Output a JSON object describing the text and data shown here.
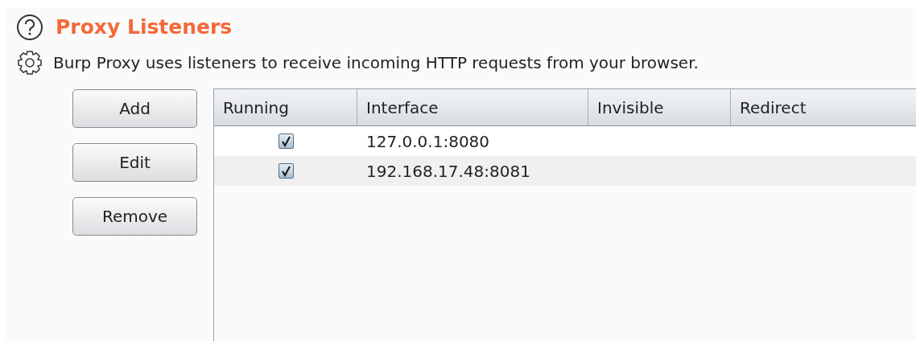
{
  "title": "Proxy Listeners",
  "description": "Burp Proxy uses listeners to receive incoming HTTP requests from your browser.",
  "buttons": [
    "Add",
    "Edit",
    "Remove"
  ],
  "table": {
    "columns": [
      "Running",
      "Interface",
      "Invisible",
      "Redirect"
    ],
    "rows": [
      {
        "running": true,
        "interface": "127.0.0.1:8080"
      },
      {
        "running": true,
        "interface": "192.168.17.48:8081"
      }
    ]
  }
}
